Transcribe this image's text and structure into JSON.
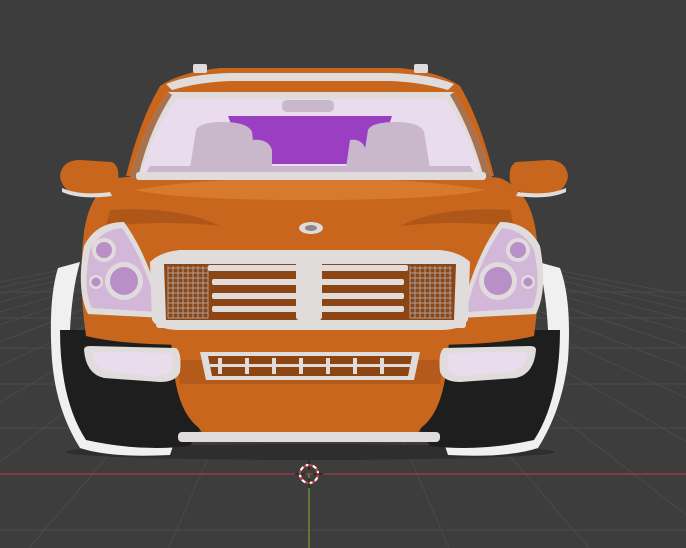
{
  "viewport": {
    "background": "#3d3d3d",
    "grid_color": "#4a4a4a",
    "x_axis_color": "#9b3a44",
    "y_axis_color": "#6c8a2e",
    "cursor": {
      "name": "3d-cursor-icon",
      "ring_colors": [
        "#d43a3a",
        "#ffffff"
      ]
    }
  },
  "model": {
    "name": "orange-suv",
    "view": "front",
    "colors": {
      "body": "#c8661e",
      "body_shade": "#8e4514",
      "body_highlight": "#e68a3d",
      "chrome": "#e0dcdc",
      "chrome_dark": "#a7a0a0",
      "glass": "#e9dcec",
      "glass_dark": "#c9b8cc",
      "interior_purple": "#9a3fc1",
      "lamp_lens": "#d2b7d9",
      "lamp_inner": "#b88fc7",
      "bumper_black": "#1e1e1e",
      "tire": "#f0f0f0"
    }
  }
}
